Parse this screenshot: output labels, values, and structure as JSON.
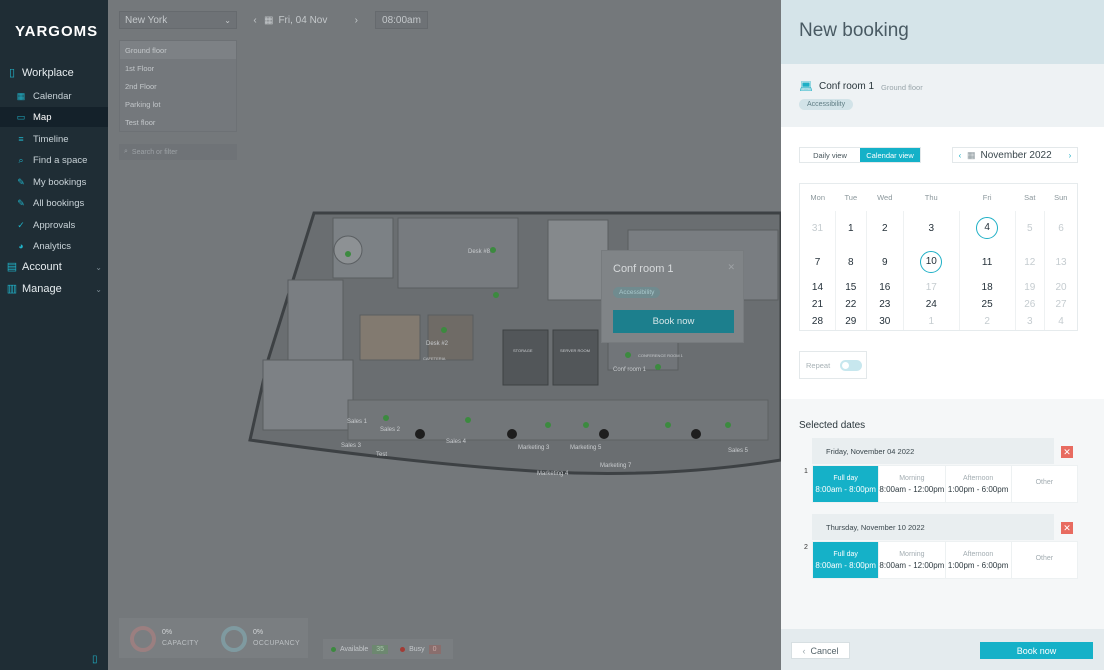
{
  "app": {
    "logo": "YARGOMS"
  },
  "sidebar": {
    "sections": [
      {
        "label": "Workplace",
        "icon": "workplace-icon"
      },
      {
        "label": "Account",
        "icon": "account-icon"
      },
      {
        "label": "Manage",
        "icon": "manage-icon"
      }
    ],
    "items": [
      {
        "label": "Calendar",
        "icon": "calendar-icon"
      },
      {
        "label": "Map",
        "icon": "map-icon"
      },
      {
        "label": "Timeline",
        "icon": "timeline-icon"
      },
      {
        "label": "Find a space",
        "icon": "search-icon"
      },
      {
        "label": "My bookings",
        "icon": "bookings-icon"
      },
      {
        "label": "All bookings",
        "icon": "all-bookings-icon"
      },
      {
        "label": "Approvals",
        "icon": "check-icon"
      },
      {
        "label": "Analytics",
        "icon": "analytics-icon"
      }
    ],
    "active_item": "Map"
  },
  "map": {
    "location": "New York",
    "date": "Fri, 04 Nov",
    "time": "08:00am",
    "floors": [
      "Ground floor",
      "1st Floor",
      "2nd Floor",
      "Parking lot",
      "Test floor"
    ],
    "search_placeholder": "Search or filter",
    "labels": [
      "Desk #8",
      "Desk #2",
      "CAFETERIA",
      "STORAGE",
      "SERVER ROOM",
      "CONFERENCE ROOM 1",
      "Conf room 1",
      "Sales 1",
      "Sales 2",
      "Sales 3",
      "Sales 4",
      "Sales 5",
      "Test",
      "Marketing 3",
      "Marketing 4",
      "Marketing 5",
      "Marketing 7"
    ],
    "popup": {
      "title": "Conf room 1",
      "tag": "Accessibility",
      "button": "Book now"
    },
    "stats": {
      "capacity_value": "0%",
      "capacity_label": "CAPACITY",
      "occupancy_value": "0%",
      "occupancy_label": "OCCUPANCY"
    },
    "legend": {
      "available_label": "Available",
      "available_count": "35",
      "busy_label": "Busy",
      "busy_count": "0"
    }
  },
  "booking": {
    "title": "New booking",
    "room_name": "Conf room 1",
    "room_floor": "Ground floor",
    "room_tag": "Accessibility",
    "view_daily": "Daily view",
    "view_calendar": "Calendar view",
    "month": "November 2022",
    "weekdays": [
      "Mon",
      "Tue",
      "Wed",
      "Thu",
      "Fri",
      "Sat",
      "Sun"
    ],
    "weeks": [
      [
        "31",
        "1",
        "2",
        "3",
        "4",
        "5",
        "6"
      ],
      [
        "7",
        "8",
        "9",
        "10",
        "11",
        "12",
        "13"
      ],
      [
        "14",
        "15",
        "16",
        "17",
        "18",
        "19",
        "20"
      ],
      [
        "21",
        "22",
        "23",
        "24",
        "25",
        "26",
        "27"
      ],
      [
        "28",
        "29",
        "30",
        "1",
        "2",
        "3",
        "4"
      ]
    ],
    "selected_days": [
      "4",
      "10"
    ],
    "repeat_label": "Repeat",
    "selected_title": "Selected dates",
    "entries": [
      {
        "index": "1",
        "date": "Friday, November 04 2022",
        "slots": [
          {
            "name": "Full day",
            "time": "8:00am - 8:00pm"
          },
          {
            "name": "Morning",
            "time": "8:00am - 12:00pm"
          },
          {
            "name": "Afternoon",
            "time": "1:00pm - 6:00pm"
          },
          {
            "name": "Other",
            "time": ""
          }
        ]
      },
      {
        "index": "2",
        "date": "Thursday, November 10 2022",
        "slots": [
          {
            "name": "Full day",
            "time": "8:00am - 8:00pm"
          },
          {
            "name": "Morning",
            "time": "8:00am - 12:00pm"
          },
          {
            "name": "Afternoon",
            "time": "1:00pm - 6:00pm"
          },
          {
            "name": "Other",
            "time": ""
          }
        ]
      }
    ],
    "cancel_label": "Cancel",
    "book_label": "Book now"
  }
}
